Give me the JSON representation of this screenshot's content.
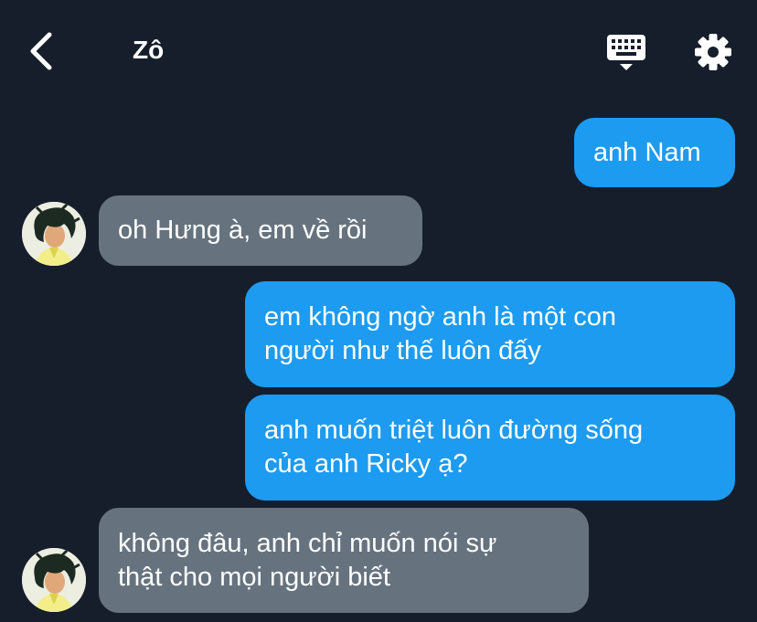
{
  "header": {
    "title": "Zô",
    "icons": {
      "back": "chevron-left-icon",
      "keyboard": "keyboard-icon",
      "settings": "gear-icon"
    }
  },
  "messages": [
    {
      "from": "me",
      "lines": [
        "anh Nam"
      ]
    },
    {
      "from": "contact",
      "lines": [
        "oh Hưng à, em về rồi"
      ]
    },
    {
      "from": "me",
      "lines": [
        "em không ngờ anh là một con",
        "người như thế luôn đấy"
      ]
    },
    {
      "from": "me",
      "lines": [
        "anh muốn triệt luôn đường sống",
        "của anh Ricky ạ?"
      ]
    },
    {
      "from": "contact",
      "lines": [
        "không đâu, anh chỉ muốn nói sự",
        "thật cho mọi người biết"
      ]
    }
  ],
  "colors": {
    "background": "#161e2b",
    "outgoing_bubble": "#1d9bf0",
    "incoming_bubble": "#66737f",
    "text": "#ffffff"
  }
}
